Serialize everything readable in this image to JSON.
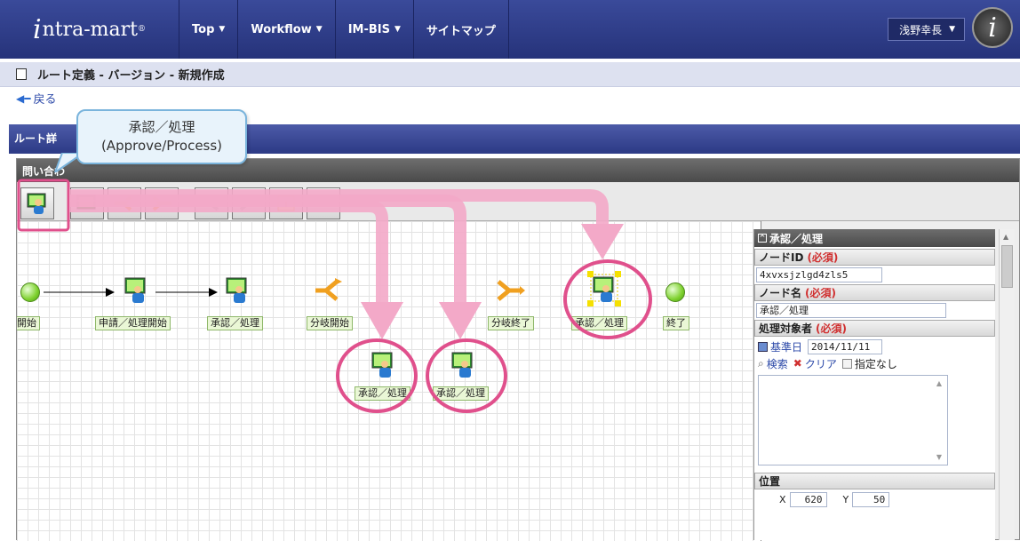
{
  "header": {
    "logo_text": "ntra-mart",
    "nav": [
      {
        "label": "Top"
      },
      {
        "label": "Workflow"
      },
      {
        "label": "IM-BIS"
      },
      {
        "label": "サイトマップ"
      }
    ],
    "user_name": "浅野幸長"
  },
  "page": {
    "title": "ルート定義 - バージョン - 新規作成",
    "back_label": "戻る",
    "section_title": "ルート詳",
    "panel_title": "問い合わ"
  },
  "callout": {
    "line1": "承認／処理",
    "line2": "(Approve/Process)"
  },
  "diagram": {
    "nodes": [
      {
        "label": "開始"
      },
      {
        "label": "申請／処理開始"
      },
      {
        "label": "承認／処理"
      },
      {
        "label": "分岐開始"
      },
      {
        "label": "承認／処理"
      },
      {
        "label": "承認／処理"
      },
      {
        "label": "分岐終了"
      },
      {
        "label": "承認／処理"
      },
      {
        "label": "終了"
      }
    ]
  },
  "properties": {
    "header": "承認／処理",
    "node_id_label": "ノードID",
    "required": "(必須)",
    "node_id_value": "4xvxsjzlgd4zls5",
    "node_name_label": "ノード名",
    "node_name_value": "承認／処理",
    "target_label": "処理対象者",
    "base_date_label": "基準日",
    "base_date_value": "2014/11/11",
    "search_label": "検索",
    "clear_label": "クリア",
    "none_label": "指定なし",
    "position_label": "位置",
    "x_label": "X",
    "x_value": "620",
    "y_label": "Y",
    "y_value": "50"
  },
  "colors": {
    "nav_bg": "#26337a",
    "highlight": "#e0508c",
    "arrow_pink": "#f3a9c8",
    "node_label_bg": "#eaf7d6",
    "required_red": "#d03030"
  }
}
